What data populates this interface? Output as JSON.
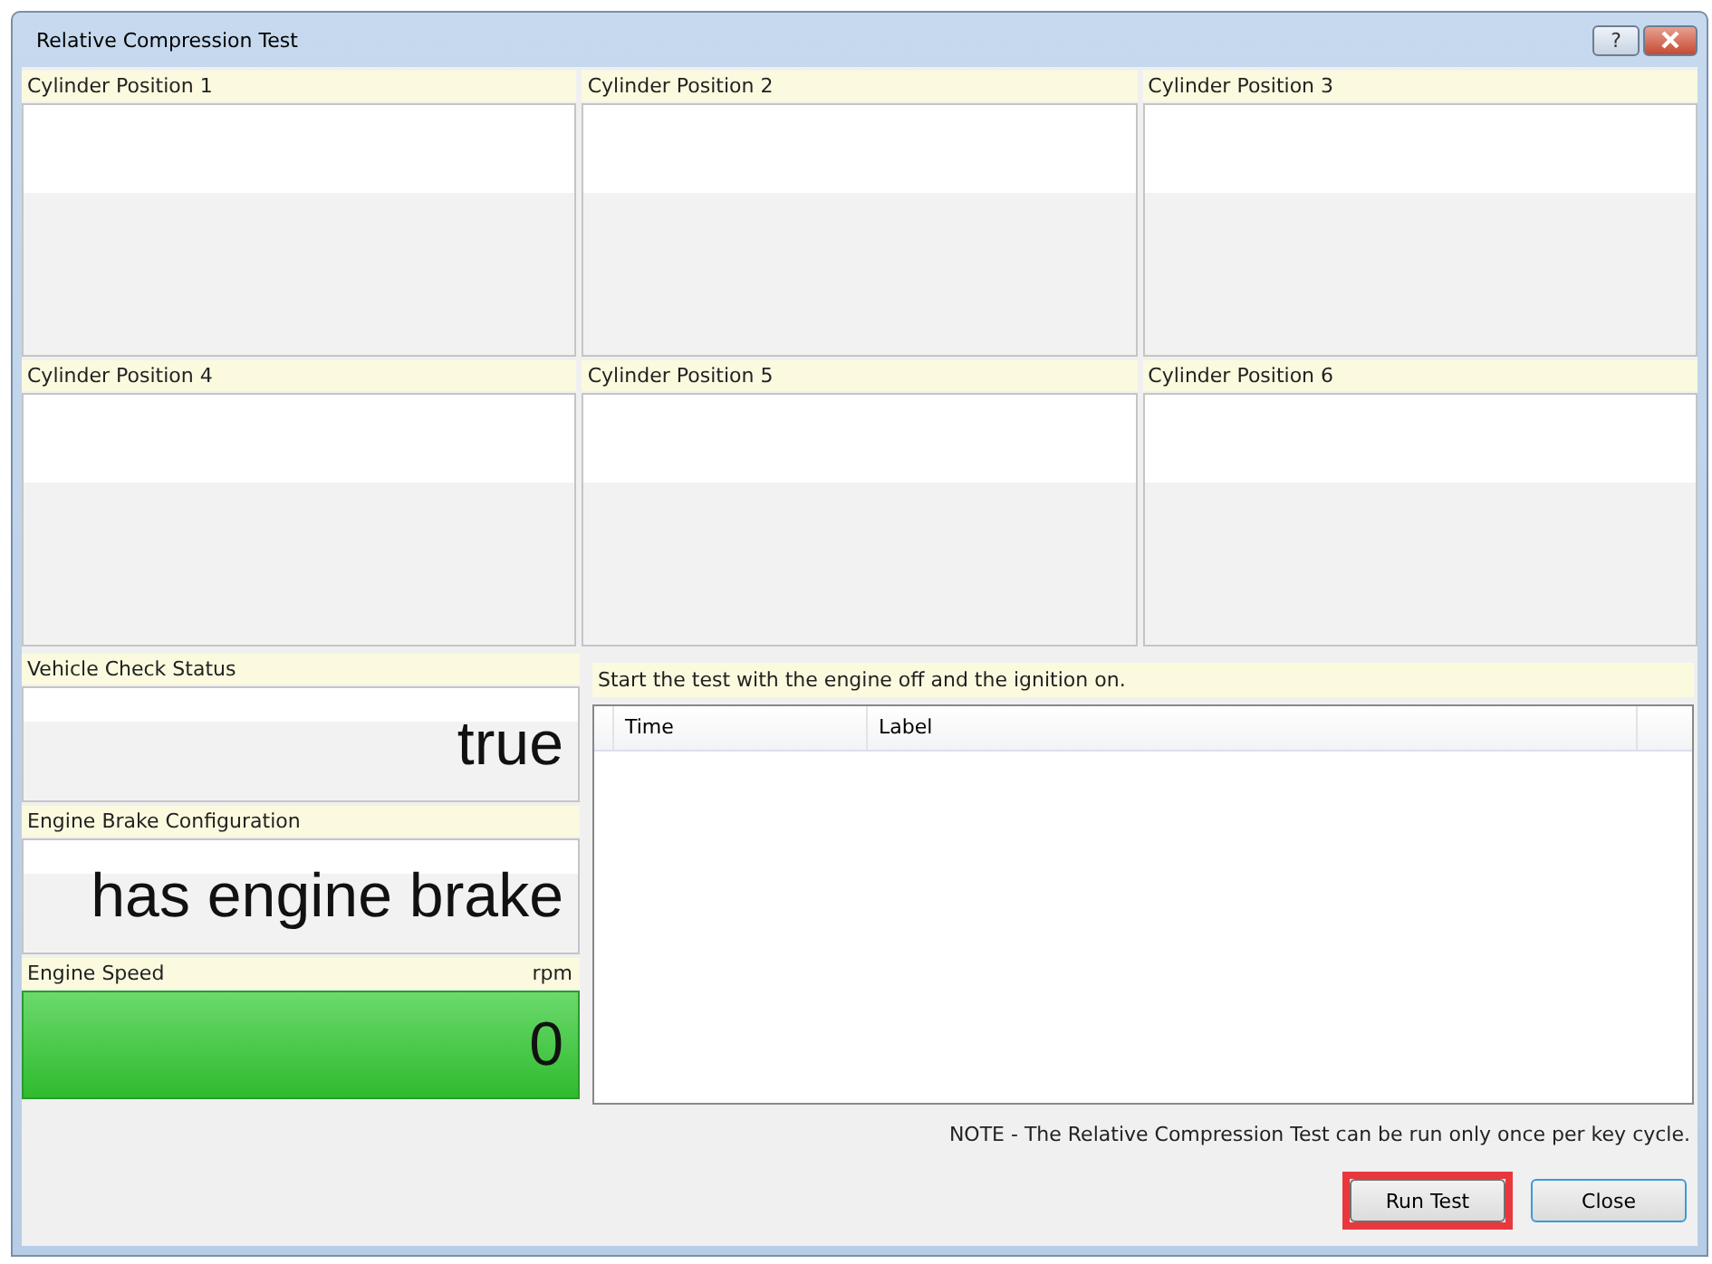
{
  "window": {
    "title": "Relative Compression Test",
    "help_button": "?"
  },
  "cylinders": [
    {
      "label": "Cylinder Position 1"
    },
    {
      "label": "Cylinder Position 2"
    },
    {
      "label": "Cylinder Position 3"
    },
    {
      "label": "Cylinder Position 4"
    },
    {
      "label": "Cylinder Position 5"
    },
    {
      "label": "Cylinder Position 6"
    }
  ],
  "status_panels": [
    {
      "kind": "plain",
      "label": "Vehicle Check Status",
      "value": "true"
    },
    {
      "kind": "plain",
      "label": "Engine Brake Configuration",
      "value": "has engine brake"
    },
    {
      "kind": "gauge",
      "label": "Engine Speed",
      "unit": "rpm",
      "value": "0"
    }
  ],
  "instruction": "Start the test with the engine off and the ignition on.",
  "log_table": {
    "columns": [
      "Time",
      "Label"
    ]
  },
  "note": "NOTE - The Relative Compression Test can be run only once per key cycle.",
  "buttons": [
    {
      "label": "Run Test",
      "highlighted": true
    },
    {
      "label": "Close",
      "highlighted": false
    }
  ]
}
